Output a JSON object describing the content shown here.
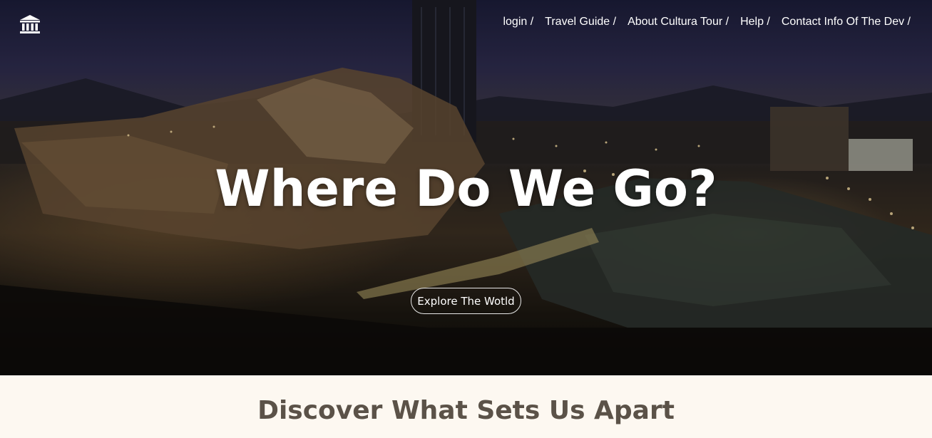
{
  "nav": {
    "items": [
      {
        "label": "login /"
      },
      {
        "label": "Travel Guide /"
      },
      {
        "label": "About Cultura Tour /"
      },
      {
        "label": "Help /"
      },
      {
        "label": "Contact Info Of The Dev /"
      }
    ]
  },
  "hero": {
    "title": "Where Do We Go?",
    "cta_label": "Explore The Wotld"
  },
  "section": {
    "title": "Discover What Sets Us Apart"
  },
  "icons": {
    "logo": "museum-icon"
  },
  "colors": {
    "hero_text": "#ffffff",
    "section_bg": "#fdf8f1",
    "section_title": "#5b5248"
  }
}
